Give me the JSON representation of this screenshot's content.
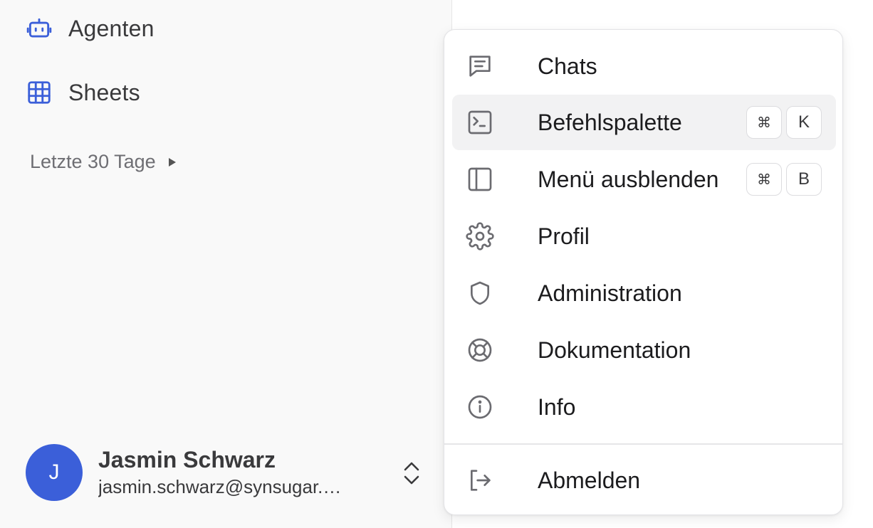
{
  "sidebar": {
    "nav": [
      {
        "label": "Agenten",
        "icon": "robot-icon"
      },
      {
        "label": "Sheets",
        "icon": "table-icon"
      }
    ],
    "section": {
      "label": "Letzte 30 Tage",
      "icon": "caret-right-icon"
    },
    "user": {
      "initial": "J",
      "name": "Jasmin Schwarz",
      "email": "jasmin.schwarz@synsugar.com",
      "email_display": "jasmin.schwarz@synsugar.…",
      "avatar_color": "#3b5fd9"
    }
  },
  "menu": {
    "items": [
      {
        "label": "Chats",
        "icon": "chat-icon"
      },
      {
        "label": "Befehlspalette",
        "icon": "terminal-icon",
        "shortcut": [
          "⌘",
          "K"
        ],
        "active": true
      },
      {
        "label": "Menü ausblenden",
        "icon": "sidebar-icon",
        "shortcut": [
          "⌘",
          "B"
        ]
      },
      {
        "label": "Profil",
        "icon": "gear-icon"
      },
      {
        "label": "Administration",
        "icon": "shield-icon"
      },
      {
        "label": "Dokumentation",
        "icon": "lifebuoy-icon"
      },
      {
        "label": "Info",
        "icon": "info-icon"
      },
      {
        "label": "Abmelden",
        "icon": "logout-icon"
      }
    ]
  },
  "colors": {
    "accent": "#3b5fd9",
    "icon_gray": "#6b6b70",
    "active_bg": "#f2f2f3"
  }
}
